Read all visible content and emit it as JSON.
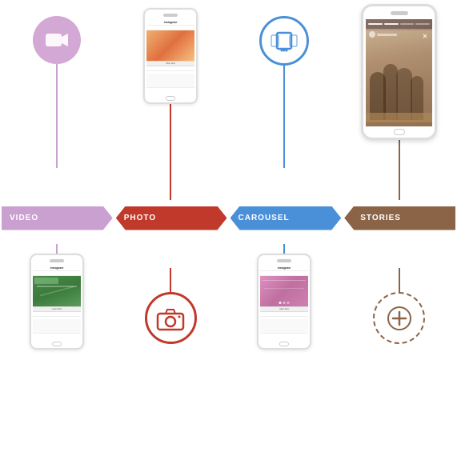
{
  "labels": {
    "video": "VIDEO",
    "photo": "PHOTO",
    "carousel": "CAROUSEL",
    "stories": "STORIES"
  },
  "colors": {
    "video": "#c9a0d0",
    "photo": "#c0392b",
    "carousel": "#4a90d9",
    "stories": "#8b6347"
  },
  "icons": {
    "video": "video-camera",
    "carousel": "carousel",
    "photo": "camera",
    "stories": "add-circle"
  }
}
